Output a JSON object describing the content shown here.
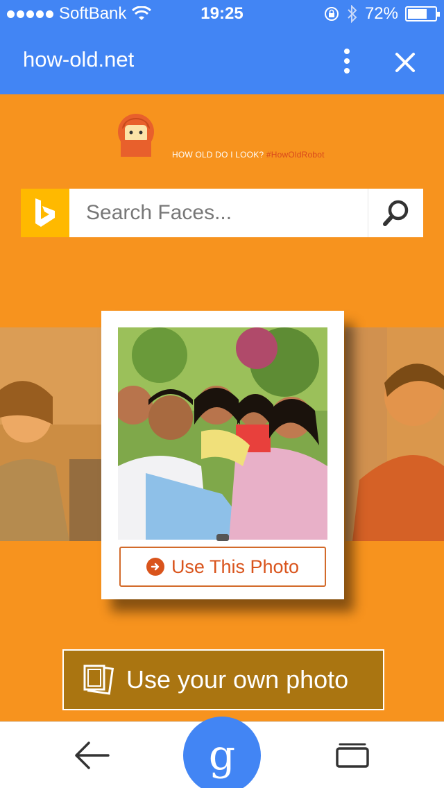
{
  "status_bar": {
    "carrier": "SoftBank",
    "time": "19:25",
    "battery_percent": "72%",
    "battery_level": 0.72
  },
  "browser": {
    "title": "how-old.net",
    "menu_icon": "more-vert-icon",
    "close_icon": "close-icon"
  },
  "header": {
    "tagline": "HOW OLD DO I LOOK?",
    "hashtag": "#HowOldRobot"
  },
  "search": {
    "placeholder": "Search Faces...",
    "icon": "search-icon",
    "logo": "bing-logo"
  },
  "card": {
    "button_label": "Use This Photo"
  },
  "own_photo": {
    "label": "Use your own photo"
  },
  "bottom_bar": {
    "back_icon": "back-arrow-icon",
    "google_label": "g",
    "tabs_icon": "tabs-icon"
  },
  "colors": {
    "brand_blue": "#4285f4",
    "page_orange": "#f7931e",
    "accent_orange": "#d9541c",
    "bing_yellow": "#ffb900",
    "own_photo_bg": "#aa7511"
  }
}
